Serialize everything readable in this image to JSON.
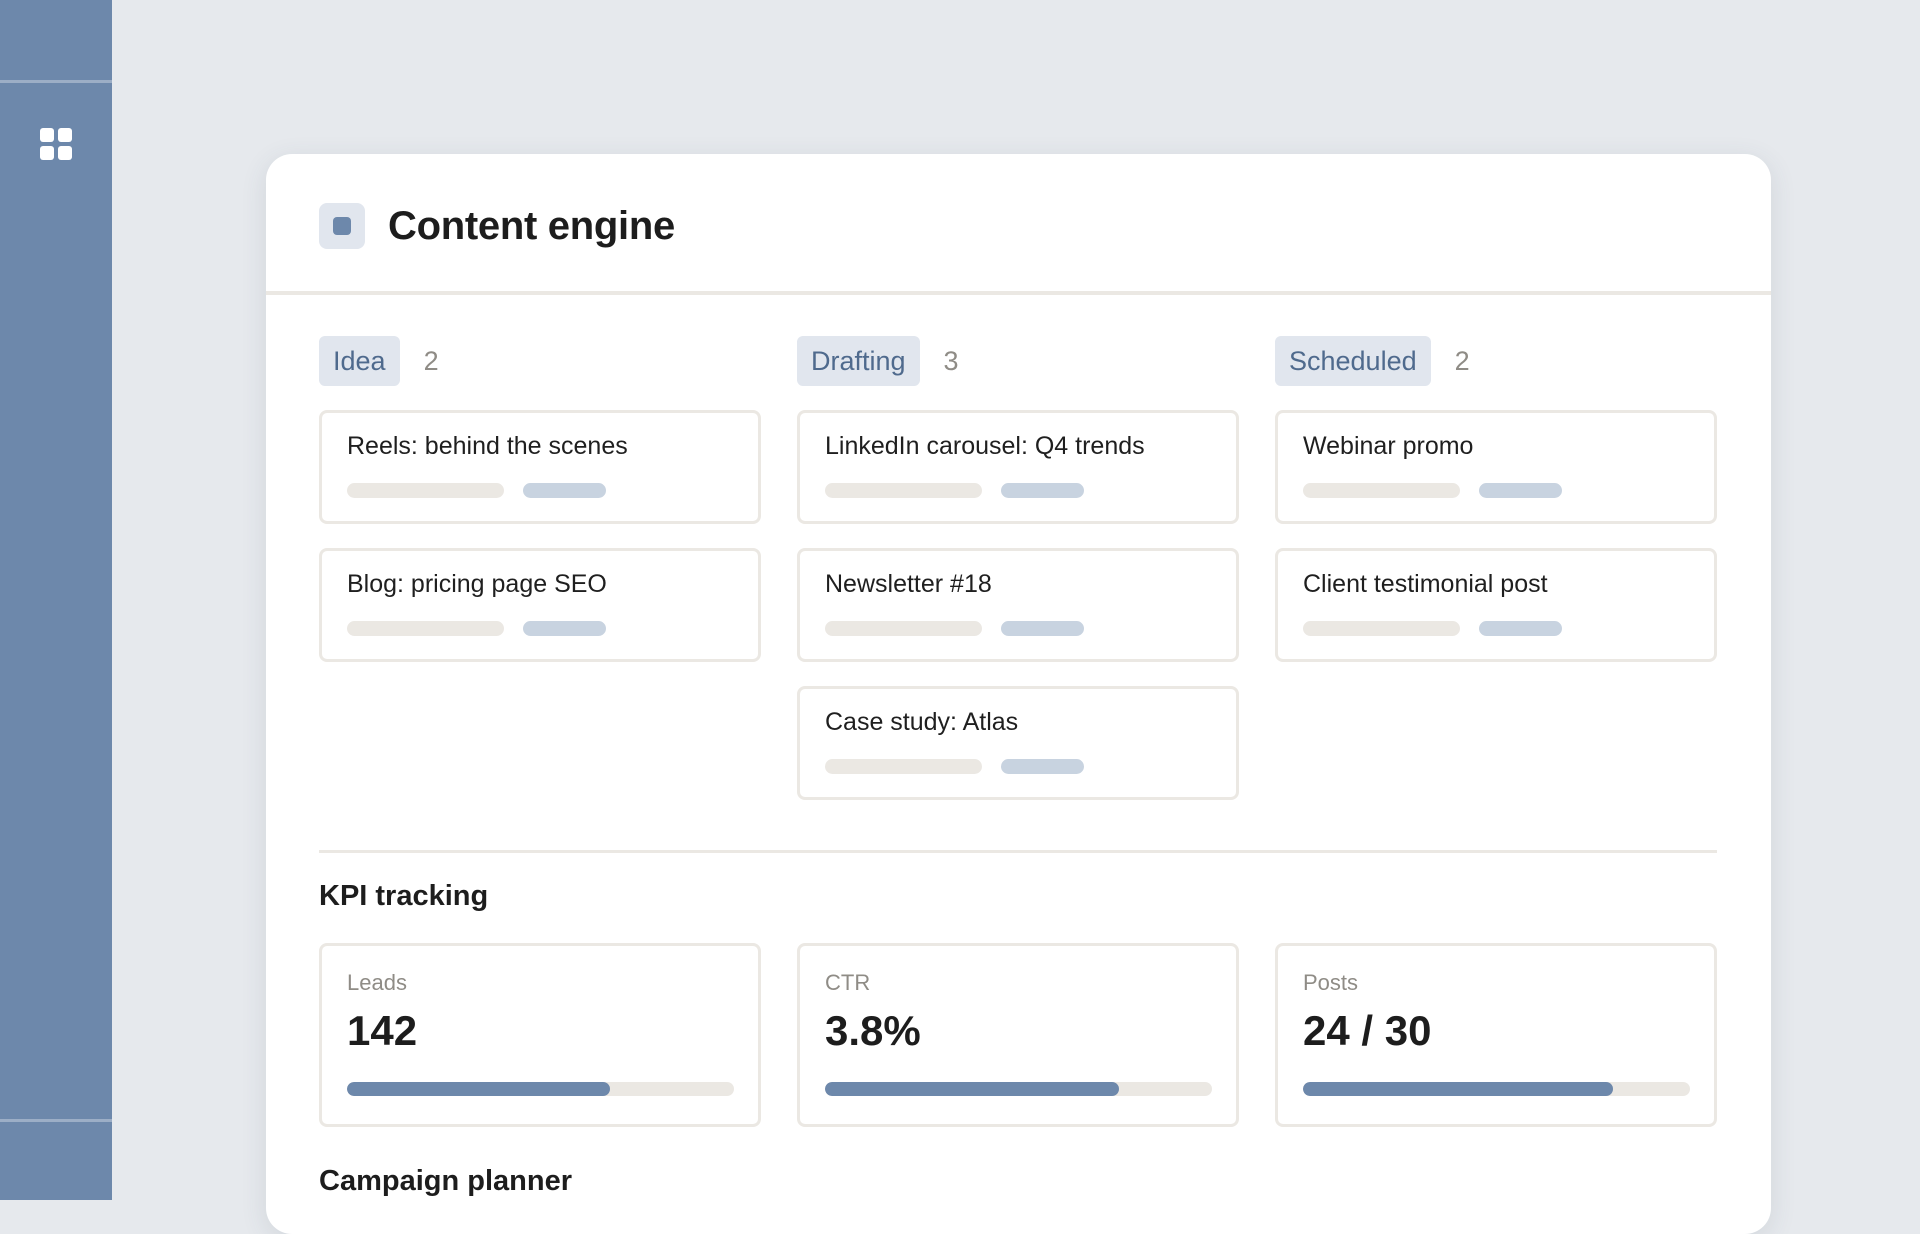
{
  "app": {
    "title": "Content engine"
  },
  "board": {
    "columns": [
      {
        "label": "Idea",
        "count": "2",
        "cards": [
          {
            "title": "Reels: behind the scenes"
          },
          {
            "title": "Blog: pricing page SEO"
          }
        ]
      },
      {
        "label": "Drafting",
        "count": "3",
        "cards": [
          {
            "title": "LinkedIn carousel: Q4 trends"
          },
          {
            "title": "Newsletter #18"
          },
          {
            "title": "Case study: Atlas"
          }
        ]
      },
      {
        "label": "Scheduled",
        "count": "2",
        "cards": [
          {
            "title": "Webinar promo"
          },
          {
            "title": "Client testimonial post"
          }
        ]
      }
    ]
  },
  "kpi": {
    "title": "KPI tracking",
    "cards": [
      {
        "label": "Leads",
        "value": "142",
        "progress": 0.68
      },
      {
        "label": "CTR",
        "value": "3.8%",
        "progress": 0.76
      },
      {
        "label": "Posts",
        "value": "24 / 30",
        "progress": 0.8
      }
    ]
  },
  "planner": {
    "title": "Campaign planner"
  },
  "colors": {
    "accent": "#6d88ab",
    "rail": "#6d88ab",
    "chip_bg": "#e1e6ee",
    "chip_text": "#4f6a8d",
    "border": "#ebe8e3",
    "background": "#e6e9ed"
  },
  "icons": {
    "rail_app": "grid-icon",
    "project": "project-icon"
  }
}
